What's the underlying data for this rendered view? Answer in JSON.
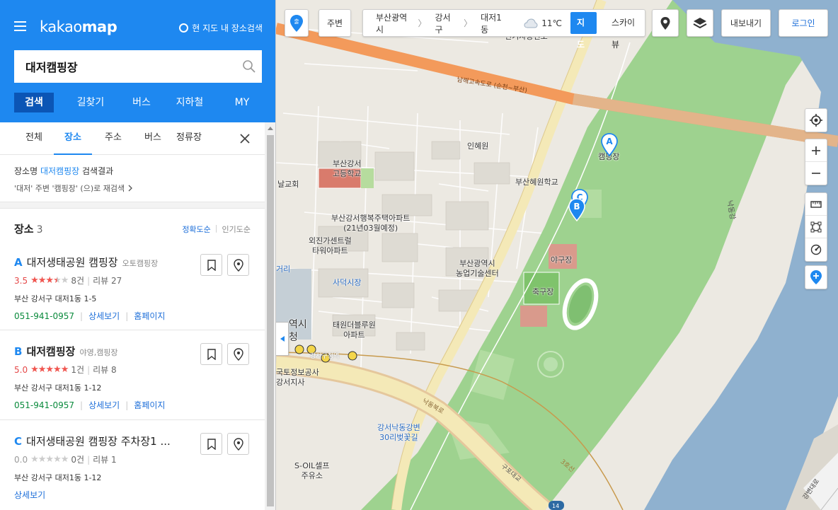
{
  "header": {
    "logo_light": "kakao",
    "logo_bold": "map",
    "current_map_search": "현 지도 내 장소검색",
    "search_value": "대저캠핑장",
    "tabs": [
      "검색",
      "길찾기",
      "버스",
      "지하철",
      "MY"
    ]
  },
  "sub_tabs": [
    "전체",
    "장소",
    "주소",
    "버스",
    "정류장"
  ],
  "summary": {
    "prefix": "장소명",
    "keyword": "대저캠핑장",
    "suffix": "검색결과",
    "research": "'대저' 주변 '캠핑장' (으)로 재검색"
  },
  "places_section": {
    "title": "장소",
    "count": "3",
    "sort_accuracy": "정확도순",
    "sort_popular": "인기도순"
  },
  "places": [
    {
      "letter": "A",
      "name": "대저생태공원 캠핑장",
      "category": "오토캠핑장",
      "score": "3.5",
      "stars": 3.5,
      "reviews_count": "8건",
      "review_label": "리뷰 27",
      "address": "부산 강서구 대저1동 1-5",
      "phone": "051-941-0957",
      "detail": "상세보기",
      "homepage": "홈페이지"
    },
    {
      "letter": "B",
      "name": "대저캠핑장",
      "category": "야영,캠핑장",
      "score": "5.0",
      "stars": 5,
      "reviews_count": "1건",
      "review_label": "리뷰 8",
      "address": "부산 강서구 대저1동 1-12",
      "phone": "051-941-0957",
      "detail": "상세보기",
      "homepage": "홈페이지"
    },
    {
      "letter": "C",
      "name": "대저생태공원 캠핑장 주차장1 ...",
      "category": "",
      "score": "0.0",
      "stars": 0,
      "reviews_count": "0건",
      "review_label": "리뷰 1",
      "address": "부산 강서구 대저1동 1-12",
      "phone": "",
      "detail": "상세보기",
      "homepage": ""
    }
  ],
  "toolbar": {
    "pin_label": "출",
    "around": "주변",
    "addr": [
      "부산광역시",
      "강서구",
      "대저1동"
    ],
    "temp": "11℃",
    "map_types": [
      "지도",
      "스카이뷰"
    ],
    "export": "내보내기",
    "login": "로그인"
  },
  "map_labels": {
    "top_cut": "전기자동건소",
    "expressway": "남해고속도로 (순천~부산)",
    "inhye": "인혜원",
    "campsite": "캠핑장",
    "school1": "부산강서\n고등학교",
    "school2": "부산혜원학교",
    "church": "날교회",
    "apt1": "부산강서행복주택아파트\n(21년03월예정)",
    "apt2": "외진가센트럴\n타워아파트",
    "agri": "부산광역시\n농업기술센터",
    "baseball": "야구장",
    "soccer": "축구장",
    "market": "사덕시장",
    "apt3": "태원더블루원\n아파트",
    "city": "역시",
    "city2": "청",
    "land": "국토정보공사\n강서지사",
    "river_bank": "강서낙동강변\n30리벚꽃길",
    "soil": "S-OIL셀프\n주유소",
    "nakdong_rd": "낙동북로",
    "gupo": "구포대교",
    "river": "낙동강",
    "gangbyeon": "강변대로",
    "r3": "3호선",
    "dist": "강서구청역",
    "guri": "거리",
    "route14": "14"
  },
  "colors": {
    "brand": "#1e88f0",
    "active_tab": "#0b55b5",
    "star": "#f05650",
    "phone": "#0a8a3c",
    "link": "#1e6fd9",
    "river": "#8fb1cf",
    "park": "#9ed28f",
    "expressway": "#f39a5b"
  }
}
